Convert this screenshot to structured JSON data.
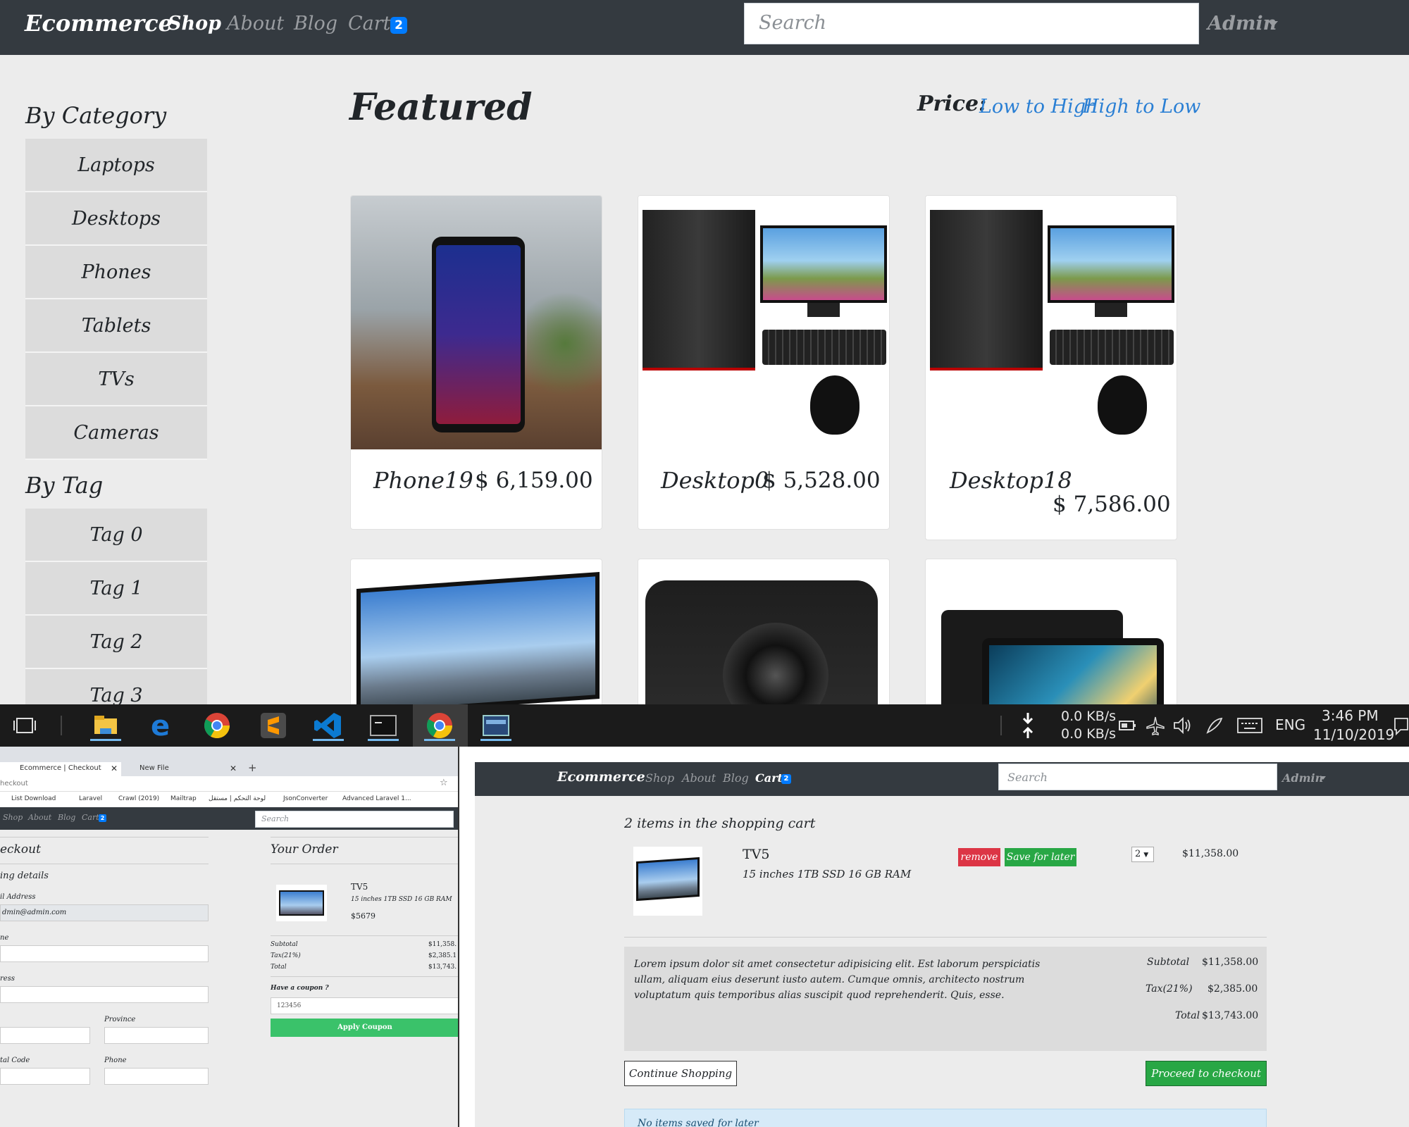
{
  "shop": {
    "brand": "Ecommerce",
    "nav": [
      {
        "label": "Shop",
        "active": true
      },
      {
        "label": "About",
        "active": false
      },
      {
        "label": "Blog",
        "active": false
      },
      {
        "label": "Cart",
        "active": false
      }
    ],
    "cart_count": "2",
    "search_placeholder": "Search",
    "user": "Admin",
    "by_category_label": "By Category",
    "categories": [
      "Laptops",
      "Desktops",
      "Phones",
      "Tablets",
      "TVs",
      "Cameras"
    ],
    "by_tag_label": "By Tag",
    "tags": [
      "Tag 0",
      "Tag 1",
      "Tag 2",
      "Tag 3"
    ],
    "featured_title": "Featured",
    "price_label": "Price:",
    "sort_low_high": "Low to High",
    "sort_high_low": "High to Low",
    "products": [
      {
        "name": "Phone19",
        "price": "$ 6,159.00",
        "icon": "phone-image"
      },
      {
        "name": "Desktop0",
        "price": "$ 5,528.00",
        "icon": "desktop-image"
      },
      {
        "name": "Desktop18",
        "price": "$ 7,586.00",
        "icon": "desktop-image"
      },
      {
        "name": "",
        "price": "",
        "icon": "tv-image"
      },
      {
        "name": "",
        "price": "",
        "icon": "camera-image"
      },
      {
        "name": "",
        "price": "",
        "icon": "tablet-image"
      }
    ]
  },
  "taskbar": {
    "net_down": "0.0 KB/s",
    "net_up": "0.0 KB/s",
    "lang": "ENG",
    "time": "3:46 PM",
    "date": "11/10/2019"
  },
  "checkout_browser": {
    "tab1": "Ecommerce | Checkout",
    "tab2": "New File",
    "url": "heckout",
    "bookmarks": [
      "List Download",
      "Laravel",
      "Crawl (2019)",
      "Mailtrap",
      "لوحة التحكم | مستقل",
      "JsonConverter",
      "Advanced Laravel 1..."
    ],
    "nav": [
      "Shop",
      "About",
      "Blog",
      "Cart"
    ],
    "cart_count": "2",
    "search_placeholder": "Search",
    "checkout_title": "eckout",
    "billing": "ing details",
    "email_label": "il Address",
    "email_value": "dmin@admin.com",
    "name_label": "ne",
    "address_label": "ress",
    "province_label": "Province",
    "postal_label": "tal Code",
    "phone_label": "Phone",
    "your_order": "Your Order",
    "item_name": "TV5",
    "item_desc": "15 inches 1TB SSD 16 GB RAM",
    "item_price": "$5679",
    "subtotal_label": "Subtotal",
    "subtotal": "$11,358.",
    "tax_label": "Tax(21%)",
    "tax": "$2,385.1",
    "total_label": "Total",
    "total": "$13,743.",
    "coupon_label": "Have a coupon ?",
    "coupon_value": "123456",
    "apply": "Apply Coupon"
  },
  "cart": {
    "brand": "Ecommerce",
    "nav": [
      "Shop",
      "About",
      "Blog",
      "Cart"
    ],
    "cart_count": "2",
    "search_placeholder": "Search",
    "user": "Admin",
    "items_heading": "2 items in the shopping cart",
    "item_name": "TV5",
    "item_desc": "15 inches 1TB SSD 16 GB RAM",
    "remove": "remove",
    "save_later": "Save for later",
    "qty": "2",
    "item_price": "$11,358.00",
    "lorem": "Lorem ipsum dolor sit amet consectetur adipisicing elit. Est laborum perspiciatis ullam, aliquam eius deserunt iusto autem. Cumque omnis, architecto nostrum voluptatum quis temporibus alias suscipit quod reprehenderit. Quis, esse.",
    "subtotal_label": "Subtotal",
    "subtotal": "$11,358.00",
    "tax_label": "Tax(21%)",
    "tax": "$2,385.00",
    "total_label": "Total",
    "total": "$13,743.00",
    "continue": "Continue Shopping",
    "proceed": "Proceed to checkout",
    "no_saved": "No items saved for later"
  },
  "colors": {
    "navbar": "#343a40",
    "accent": "#007bff",
    "success": "#28a745",
    "danger": "#dc3545"
  }
}
